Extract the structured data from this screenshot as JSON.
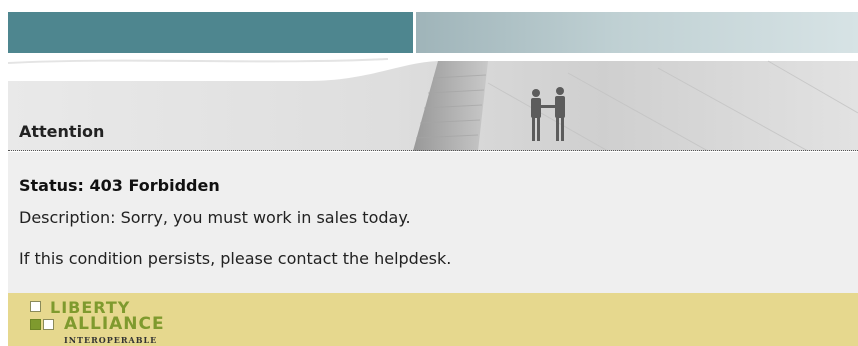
{
  "banner": {
    "title": "Attention"
  },
  "message": {
    "status": "Status: 403 Forbidden",
    "description": "Description: Sorry, you must work in sales today.",
    "condition": "If this condition persists, please contact the helpdesk."
  },
  "footer": {
    "logo_line1": "LIBERTY",
    "logo_line2": "ALLIANCE",
    "logo_line3": "INTEROPERABLE"
  },
  "colors": {
    "header_teal": "#4e868f",
    "banner_gray": "#ececec",
    "content_bg": "#efefef",
    "footer_bg": "#e6d88e",
    "logo_green": "#7f9a2e"
  }
}
